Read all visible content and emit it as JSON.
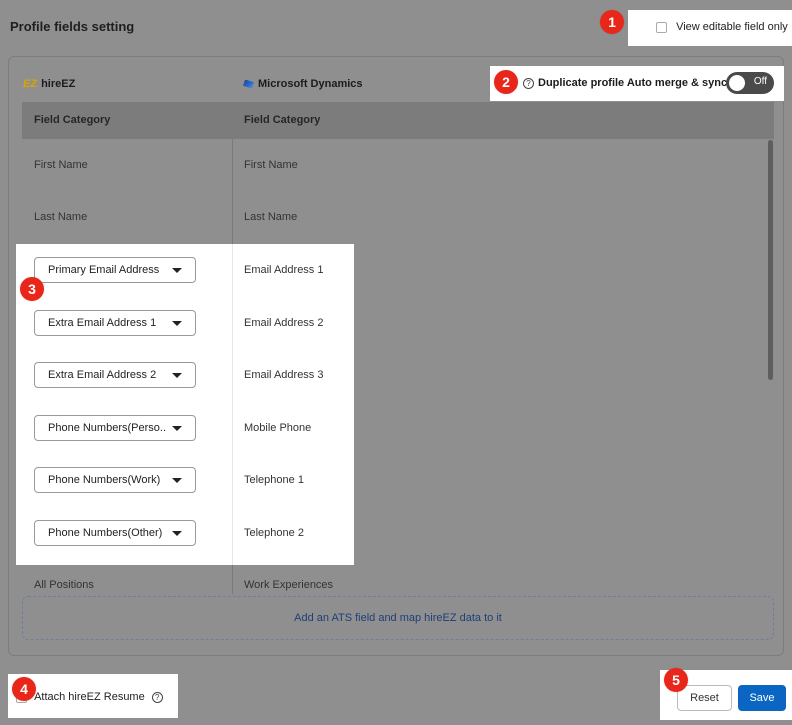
{
  "page": {
    "title": "Profile fields setting"
  },
  "callouts": [
    "1",
    "2",
    "3",
    "4",
    "5"
  ],
  "view_editable": {
    "label": "View editable field only"
  },
  "brands": {
    "left": {
      "logo": "EZ",
      "name": "hireEZ"
    },
    "right": {
      "name": "Microsoft Dynamics"
    }
  },
  "duplicate": {
    "label": "Duplicate profile Auto merge & sync",
    "toggle_text": "Off"
  },
  "table": {
    "headers": [
      "Field Category",
      "Field Category"
    ],
    "static_rows": [
      {
        "left": "First Name",
        "right": "First Name"
      },
      {
        "left": "Last Name",
        "right": "Last Name"
      }
    ],
    "mapped_rows": [
      {
        "select": "Primary Email Address",
        "right": "Email Address 1"
      },
      {
        "select": "Extra Email Address 1",
        "right": "Email Address 2"
      },
      {
        "select": "Extra Email Address 2",
        "right": "Email Address 3"
      },
      {
        "select": "Phone Numbers(Perso...",
        "right": "Mobile Phone"
      },
      {
        "select": "Phone Numbers(Work)",
        "right": "Telephone 1"
      },
      {
        "select": "Phone Numbers(Other)",
        "right": "Telephone 2"
      }
    ],
    "partial_row": {
      "left": "All Positions",
      "right": "Work Experiences"
    },
    "add_row": "Add an ATS field and map hireEZ data to it"
  },
  "footer": {
    "attach_label": "Attach hireEZ Resume",
    "reset": "Reset",
    "save": "Save"
  },
  "colors": {
    "accent": "#0a66c2",
    "badge": "#e8261a"
  }
}
